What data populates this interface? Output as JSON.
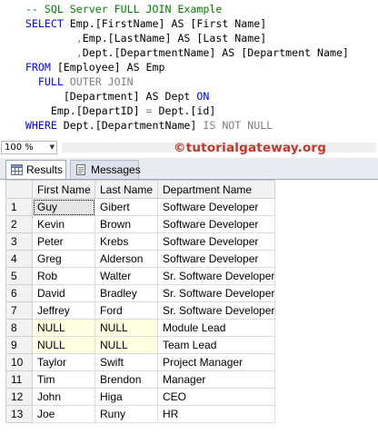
{
  "editor": {
    "comment": "-- SQL Server FULL JOIN Example",
    "select_kw": "SELECT",
    "line1_rest": " Emp.[FirstName] AS [First Name]",
    "line2_comma": ",",
    "line2_rest": "Emp.[LastName] AS [Last Name]",
    "line3_comma": ",",
    "line3_rest": "Dept.[DepartmentName] AS [Department Name]",
    "from_kw": "FROM",
    "from_rest": " [Employee] AS Emp",
    "full_kw": "FULL",
    "outer_join": " OUTER JOIN",
    "dept_table": "[Department] AS Dept ",
    "on_kw": "ON",
    "join_cond_a": "Emp.[DepartID] ",
    "eq": "=",
    "join_cond_b": " Dept.[id]",
    "where_kw": "WHERE",
    "where_rest": " Dept.[DepartmentName] ",
    "is_not_null": "IS NOT NULL",
    "as_kw": "AS"
  },
  "toolbar": {
    "zoom_value": "100 %",
    "watermark": "©tutorialgateway.org"
  },
  "tabs": {
    "results_label": "Results",
    "messages_label": "Messages"
  },
  "grid": {
    "columns": [
      "First Name",
      "Last Name",
      "Department Name"
    ],
    "rows": [
      {
        "n": "1",
        "first": "Guy",
        "last": "Gibert",
        "dept": "Software Developer"
      },
      {
        "n": "2",
        "first": "Kevin",
        "last": "Brown",
        "dept": "Software Developer"
      },
      {
        "n": "3",
        "first": "Peter",
        "last": "Krebs",
        "dept": "Software Developer"
      },
      {
        "n": "4",
        "first": "Greg",
        "last": "Alderson",
        "dept": "Software Developer"
      },
      {
        "n": "5",
        "first": "Rob",
        "last": "Walter",
        "dept": "Sr. Software Developer"
      },
      {
        "n": "6",
        "first": "David",
        "last": "Bradley",
        "dept": "Sr. Software Developer"
      },
      {
        "n": "7",
        "first": "Jeffrey",
        "last": "Ford",
        "dept": "Sr. Software Developer"
      },
      {
        "n": "8",
        "first": "NULL",
        "last": "NULL",
        "dept": "Module Lead"
      },
      {
        "n": "9",
        "first": "NULL",
        "last": "NULL",
        "dept": "Team Lead"
      },
      {
        "n": "10",
        "first": "Taylor",
        "last": "Swift",
        "dept": "Project Manager"
      },
      {
        "n": "11",
        "first": "Tim",
        "last": "Brendon",
        "dept": "Manager"
      },
      {
        "n": "12",
        "first": "John",
        "last": "Higa",
        "dept": "CEO"
      },
      {
        "n": "13",
        "first": "Joe",
        "last": "Runy",
        "dept": "HR"
      }
    ]
  },
  "colors": {
    "keyword": "#0000ff",
    "comment": "#008000",
    "gray_keyword": "#808080",
    "function": "#ff00ff",
    "watermark": "#c0392b",
    "null_cell": "#ffffe1"
  }
}
